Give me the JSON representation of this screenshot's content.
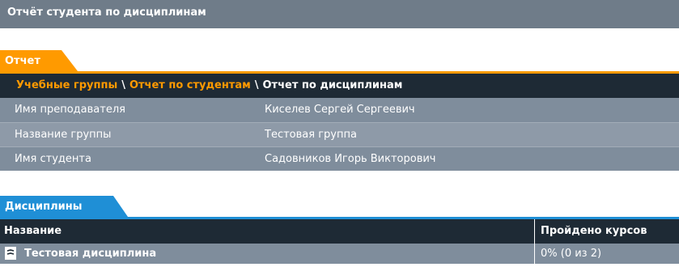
{
  "page": {
    "title": "Отчёт студента по дисциплинам"
  },
  "report_tab": {
    "label": "Отчет"
  },
  "breadcrumb": {
    "items": [
      {
        "label": "Учебные группы",
        "link": true
      },
      {
        "label": "Отчет по студентам",
        "link": true
      },
      {
        "label": "Отчет по дисциплинам",
        "link": false
      }
    ],
    "separator": "\\"
  },
  "info": [
    {
      "label": "Имя преподавателя",
      "value": "Киселев Сергей Сергеевич"
    },
    {
      "label": "Название группы",
      "value": "Тестовая группа"
    },
    {
      "label": "Имя студента",
      "value": "Садовников Игорь Викторович"
    }
  ],
  "disciplines_tab": {
    "label": "Дисциплины"
  },
  "disciplines_table": {
    "columns": [
      "Название",
      "Пройдено курсов"
    ],
    "rows": [
      {
        "name": "Тестовая дисциплина",
        "progress": "0% (0 из 2)",
        "icon": "document-icon"
      }
    ]
  },
  "colors": {
    "header_bg": "#6f7c89",
    "orange_accent": "#ff9a00",
    "blue_accent": "#1f8fd6",
    "dark_bar": "#1e2a35",
    "row_bg": "#7f8d9c"
  }
}
